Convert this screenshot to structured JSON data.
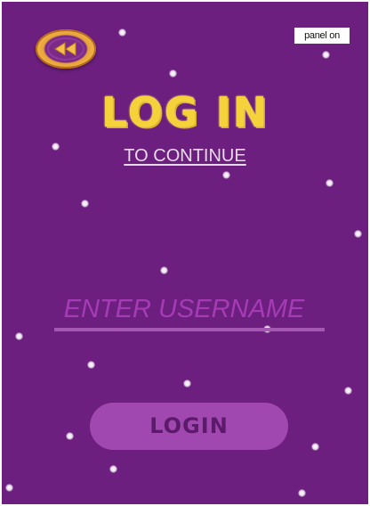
{
  "header": {
    "back_icon": "rewind-icon",
    "panel_label": "panel on"
  },
  "login": {
    "title": "LOG IN",
    "subtitle": "TO CONTINUE",
    "username_placeholder": "ENTER USERNAME",
    "username_value": "",
    "button_label": "LOGIN"
  },
  "colors": {
    "background": "#6c1f7e",
    "title": "#f6d23a",
    "input_text": "#a63bb6",
    "button_fill": "#a048af",
    "button_text": "#5c1a6b",
    "back_button_ring": "#e7a137"
  }
}
